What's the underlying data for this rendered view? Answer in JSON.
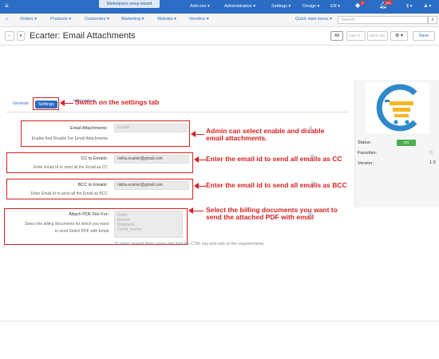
{
  "topbar": {
    "menu_icon": "hamburger-icon",
    "wizard_label": "Marketplace setup wizard",
    "addons": "Add-ons ▾",
    "administration": "Administration ▾",
    "settings": "Settings ▾",
    "design": "Design ▾",
    "language": "EN ▾",
    "notification_count_1": "2",
    "notification_count_2": "101",
    "currency": "$ ▾",
    "user": "♟ ▾"
  },
  "nav": {
    "home_icon": "home-icon",
    "orders": "Orders ▾",
    "products": "Products ▾",
    "customers": "Customers ▾",
    "marketing": "Marketing ▾",
    "website": "Website ▾",
    "vendors": "Vendors ▾",
    "quick_start": "Quick start menu ▾",
    "search_placeholder": "Search"
  },
  "header": {
    "title": "Ecarter: Email Attachments",
    "all_label": "All",
    "store_input_1": "main cl",
    "store_input_2": "demo Sto",
    "save_label": "Save"
  },
  "tabs": {
    "general": "General",
    "settings": "Settings",
    "information": "Information"
  },
  "fields": {
    "email_attachments": {
      "label": "Email Attachments:",
      "help": "Enable And Disable For Email Attachments",
      "value": "Enable"
    },
    "cc": {
      "label": "CC to Emails:",
      "help": "Enter Email Id to send all the Email as CC",
      "value": "nisha.ecarter@gmail.com"
    },
    "bcc": {
      "label": "BCC to Emails:",
      "help": "Enter Email Id to send all the Email as BCC",
      "value": "nisha.ecarter@gmail.com"
    },
    "pdf": {
      "label": "Attach PDF File For:",
      "help_line1": "Select the billing documents for which you want",
      "help_line2": "to send Select PDF with Email",
      "options": [
        "Order",
        "Invoice",
        "Shipment",
        "Credit_memo"
      ],
      "note": "To select several items, press and hold the CTRL key and click on the required items."
    }
  },
  "callouts": {
    "settings_tab": "Switch on the settings tab",
    "enable_line1": "Admin can select enable and disable",
    "enable_line2": "email attachments.",
    "cc": "Enter the email id to send all emails as CC",
    "bcc": "Enter the email id to send all emails as BCC",
    "pdf_line1": "Select the billing documents you want to",
    "pdf_line2": "send the attached PDF with email"
  },
  "sidebar": {
    "status_label": "Status:",
    "status_value": "ON",
    "favorites_label": "Favorites:",
    "version_label": "Version:",
    "version_value": "1.0"
  },
  "colors": {
    "brand_blue": "#2b6cc4",
    "annotation_red": "#d62020",
    "status_green": "#4caf50",
    "logo_blue": "#2f89c9",
    "logo_orange": "#f5b724"
  }
}
